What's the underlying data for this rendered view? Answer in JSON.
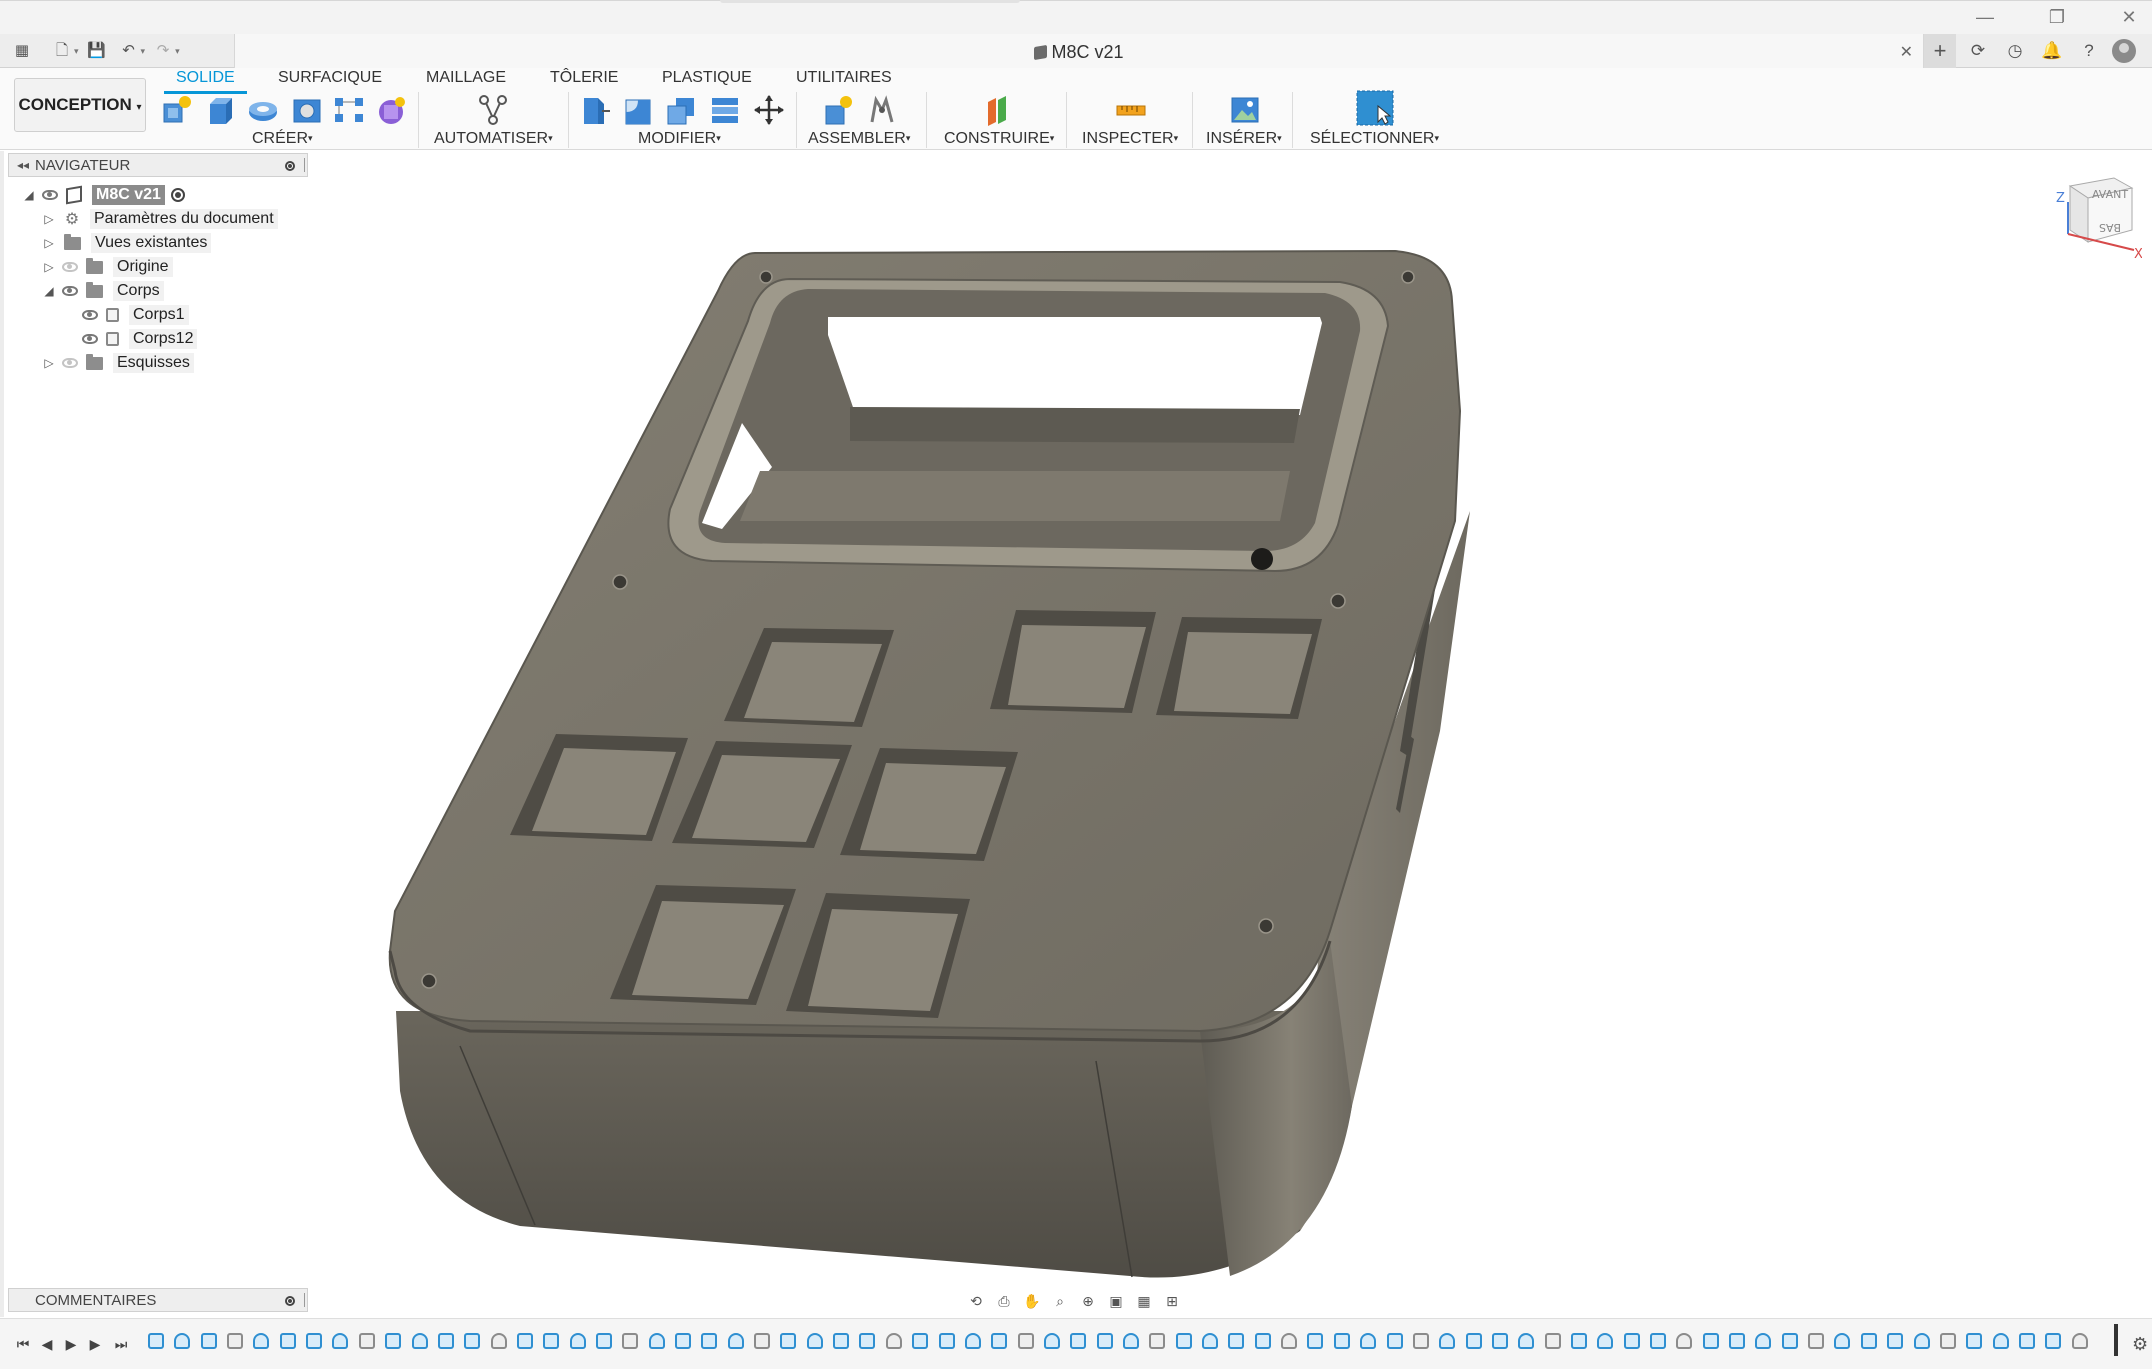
{
  "document": {
    "tab_title": "M8C v21",
    "close_glyph": "✕"
  },
  "window_controls": {
    "minimize": "—",
    "restore": "❐",
    "close": "✕"
  },
  "quick_access": {
    "grid_icon": "▦",
    "file_icon": "🗋",
    "save_icon": "💾",
    "undo_icon": "↶",
    "redo_icon": "↷",
    "caret": "▾"
  },
  "right_toolbar": {
    "new_tab": "+",
    "extensions": "⟳",
    "job_status": "◷",
    "notifications": "🔔",
    "help": "?"
  },
  "workspace": {
    "label": "CONCEPTION",
    "caret": "▾"
  },
  "ribbon_tabs": [
    {
      "label": "SOLIDE",
      "active": true
    },
    {
      "label": "SURFACIQUE",
      "active": false
    },
    {
      "label": "MAILLAGE",
      "active": false
    },
    {
      "label": "TÔLERIE",
      "active": false
    },
    {
      "label": "PLASTIQUE",
      "active": false
    },
    {
      "label": "UTILITAIRES",
      "active": false
    }
  ],
  "ribbon_groups": [
    {
      "label": "CRÉER",
      "caret": "▾"
    },
    {
      "label": "AUTOMATISER",
      "caret": "▾"
    },
    {
      "label": "MODIFIER",
      "caret": "▾"
    },
    {
      "label": "ASSEMBLER",
      "caret": "▾"
    },
    {
      "label": "CONSTRUIRE",
      "caret": "▾"
    },
    {
      "label": "INSPECTER",
      "caret": "▾"
    },
    {
      "label": "INSÉRER",
      "caret": "▾"
    },
    {
      "label": "SÉLECTIONNER",
      "caret": "▾"
    }
  ],
  "colors": {
    "accent": "#0696d7",
    "model_top": "#7b776c",
    "model_side": "#625f56",
    "timeline_feature": "#2f8fd1"
  },
  "navigator": {
    "title": "NAVIGATEUR",
    "collapse_glyph": "◂◂",
    "root": "M8C v21",
    "items": [
      {
        "label": "Paramètres du document",
        "toggle": "▷"
      },
      {
        "label": "Vues existantes",
        "toggle": "▷"
      },
      {
        "label": "Origine",
        "toggle": "▷"
      },
      {
        "label": "Corps",
        "toggle": "◢"
      },
      {
        "label": "Corps1"
      },
      {
        "label": "Corps12"
      },
      {
        "label": "Esquisses",
        "toggle": "▷"
      }
    ],
    "root_toggle": "◢"
  },
  "comments": {
    "title": "COMMENTAIRES"
  },
  "viewcube": {
    "front": "AVANT",
    "bottom": "BAS",
    "axis_z": "Z",
    "axis_x": "X"
  },
  "nav_bar": {
    "orbit": "⟲",
    "look": "⎙",
    "pan": "✋",
    "zoom_window": "⌕",
    "fit": "⊕",
    "display": "▣",
    "grid": "▦",
    "viewports": "⊞"
  },
  "timeline": {
    "first": "⏮",
    "prev": "◀",
    "play": "▶",
    "next": "▶",
    "last": "⏭",
    "gear": "⚙",
    "feature_count": 74
  }
}
